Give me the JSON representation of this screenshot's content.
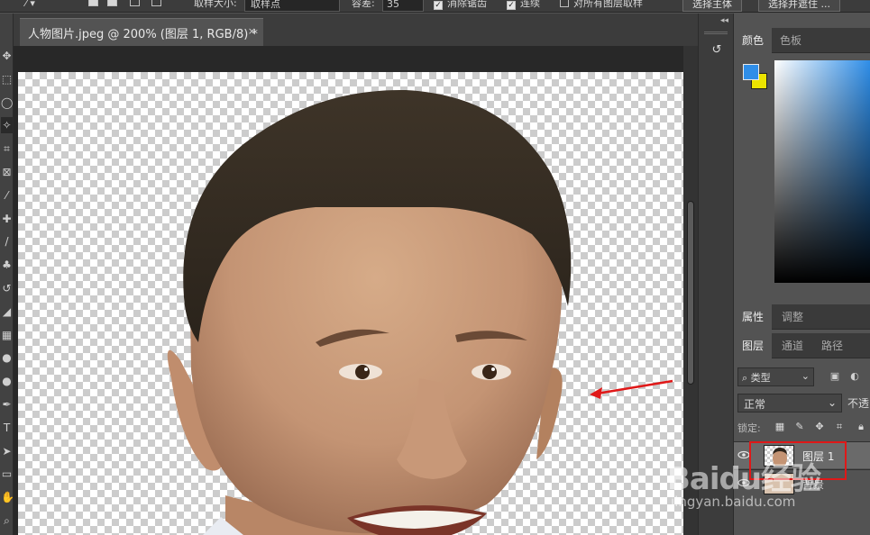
{
  "options_bar": {
    "sample_size_label": "取样大小:",
    "sample_size_value": "取样点",
    "tolerance_label": "容差:",
    "tolerance_value": "35",
    "antialias_label": "消除锯齿",
    "contiguous_label": "连续",
    "sample_all_label": "对所有图层取样",
    "select_subject_label": "选择主体",
    "select_mask_label": "选择并遮住 ..."
  },
  "document": {
    "tab_title": "人物图片.jpeg @ 200% (图层 1, RGB/8) *",
    "close_glyph": "×"
  },
  "toolbar": {
    "tools": [
      {
        "name": "move-tool-icon",
        "glyph": "✥"
      },
      {
        "name": "marquee-tool-icon",
        "glyph": "⬚"
      },
      {
        "name": "lasso-tool-icon",
        "glyph": "◯"
      },
      {
        "name": "magic-wand-tool-icon",
        "glyph": "✧"
      },
      {
        "name": "crop-tool-icon",
        "glyph": "⌗"
      },
      {
        "name": "frame-tool-icon",
        "glyph": "⊠"
      },
      {
        "name": "eyedropper-tool-icon",
        "glyph": "⁄"
      },
      {
        "name": "healing-brush-tool-icon",
        "glyph": "✚"
      },
      {
        "name": "brush-tool-icon",
        "glyph": "/"
      },
      {
        "name": "clone-stamp-tool-icon",
        "glyph": "♣"
      },
      {
        "name": "history-brush-tool-icon",
        "glyph": "↺"
      },
      {
        "name": "eraser-tool-icon",
        "glyph": "◢"
      },
      {
        "name": "gradient-tool-icon",
        "glyph": "▦"
      },
      {
        "name": "blur-tool-icon",
        "glyph": "●"
      },
      {
        "name": "dodge-tool-icon",
        "glyph": "●"
      },
      {
        "name": "pen-tool-icon",
        "glyph": "✒"
      },
      {
        "name": "type-tool-icon",
        "glyph": "T"
      },
      {
        "name": "path-selection-tool-icon",
        "glyph": "➤"
      },
      {
        "name": "rectangle-tool-icon",
        "glyph": "▭"
      },
      {
        "name": "hand-tool-icon",
        "glyph": "✋"
      },
      {
        "name": "zoom-tool-icon",
        "glyph": "⌕"
      }
    ]
  },
  "color_panel": {
    "tab_color": "颜色",
    "tab_swatches": "色板",
    "foreground_color": "#2f8ee8",
    "background_color": "#ece400"
  },
  "properties_panel": {
    "tab_properties": "属性",
    "tab_adjustments": "调整"
  },
  "layers_panel": {
    "tab_layers": "图层",
    "tab_channels": "通道",
    "tab_paths": "路径",
    "filter_label": "类型",
    "blend_mode": "正常",
    "opacity_label": "不透",
    "lock_label": "锁定:",
    "layers": [
      {
        "name": "图层 1",
        "selected": true
      },
      {
        "name": "背景",
        "selected": false
      }
    ]
  },
  "watermark": {
    "logo": "Baidu经验",
    "url": "jingyan.baidu.com"
  },
  "annotation": {
    "arrow_color": "#e01818",
    "box_color": "#e01818"
  }
}
